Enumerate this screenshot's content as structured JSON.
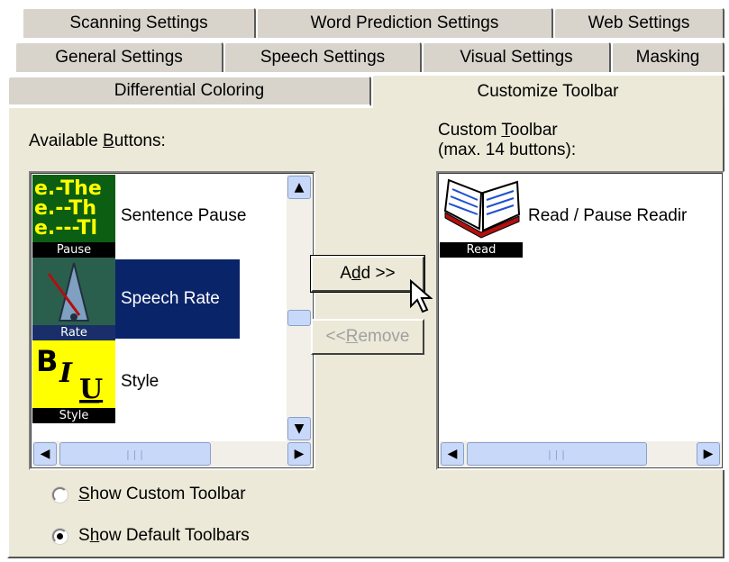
{
  "tabs": {
    "row1": [
      "Scanning Settings",
      "Word Prediction Settings",
      "Web Settings"
    ],
    "row2": [
      "General Settings",
      "Speech Settings",
      "Visual Settings",
      "Masking"
    ],
    "row3": [
      "Differential Coloring",
      "Customize Toolbar"
    ],
    "active": "Customize Toolbar"
  },
  "available": {
    "label_pre": "Available ",
    "label_mnemonic": "B",
    "label_post": "uttons:",
    "items": [
      {
        "label": "Sentence Pause",
        "caption": "Pause",
        "icon": "sentence-pause-icon",
        "selected": false
      },
      {
        "label": "Speech Rate",
        "caption": "Rate",
        "icon": "metronome-icon",
        "selected": true
      },
      {
        "label": "Style",
        "caption": "Style",
        "icon": "biu-style-icon",
        "selected": false
      }
    ]
  },
  "custom": {
    "label_pre": "Custom ",
    "label_mnemonic": "T",
    "label_post": "oolbar",
    "label_line2": "(max. 14 buttons):",
    "items": [
      {
        "label": "Read / Pause Readir",
        "caption": "Read",
        "icon": "open-book-icon"
      }
    ]
  },
  "buttons": {
    "add": {
      "pre": "A",
      "mnemonic": "d",
      "post": "d >>"
    },
    "remove": {
      "pre": "<< ",
      "mnemonic": "R",
      "post": "emove"
    }
  },
  "radios": {
    "show_custom": {
      "mnemonic": "S",
      "rest": "how Custom Toolbar",
      "checked": false
    },
    "show_default": {
      "pre": "S",
      "mnemonic": "h",
      "rest": "ow Default Toolbars",
      "checked": true
    }
  },
  "scrollbar": {
    "grip": "|||"
  },
  "colors": {
    "selection": "#0a246a",
    "panel": "#ece9d8",
    "scroll_accent": "#c8d8f8"
  }
}
